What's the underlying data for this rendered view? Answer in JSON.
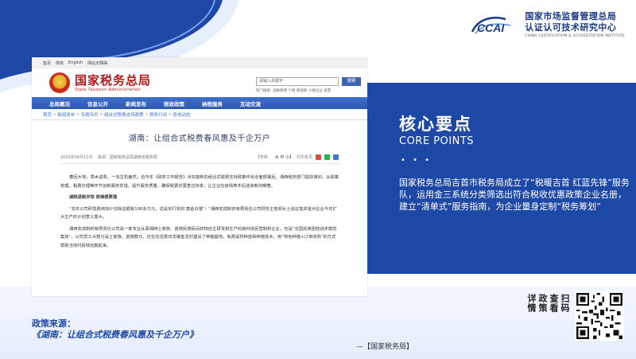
{
  "header": {
    "logo_mark": "CCAI",
    "org_name_line1": "国家市场监督管理总局",
    "org_name_line2": "认证认可技术研究中心",
    "org_name_en": "CHINA CERTIFICATION & ACCREDITATION INSTITUTE"
  },
  "screenshot": {
    "topbar": [
      "首页",
      "简体",
      "English",
      "网站无障碍"
    ],
    "site_title": "国家税务总局",
    "site_title_en": "State Taxation Administration",
    "search_placeholder": "请输入关键字",
    "search_button": "搜索",
    "hot_words": "热门搜索: 减税降费 个税 增值税 小微企业 发票",
    "nav": [
      "总局概况",
      "信息公开",
      "新闻发布",
      "税收政策",
      "纳税服务",
      "互动交流"
    ],
    "breadcrumb": [
      "首页",
      "新闻发布",
      "专题专栏",
      "组合式税费支持政策",
      "税务行动",
      "各地动态"
    ],
    "article_title": "湖南：让组合式税费春风惠及千企万户",
    "article_date": "2022年04月11日",
    "article_source": "来源：国家税务总局湖南省税务局",
    "font_label": "【字体：",
    "font_sizes": "大 中 小】",
    "print_label": "打印本页",
    "body": [
      "春回大地，草木返青，一派生机盎然。自今年《政府工作报告》对实施新的组合式税费支持政策作出全面部署后，湘西税务部门提前谋划，从政策梳理、税费办理等环节创新服务举措，提升服务质量，确保税费优惠直达快享，让企业在疫情寒冬后迎来新的暖春。",
      "减税退税并举 获得感更强",
      "“去年公司研发费用加计扣除总额有100多万元，这是实打实的‘真金白银’！”湘西宏成制药有限责任公司财务主管郑女士谈这笔资金对企业今年扩大生产的计划意义重大。",
      "湘西宏成制药有限责任公司是一家专业从事湘西土家族、苗族民族民间药物自主研发和生产的高科技民营制药企业，也是“全国民族团结进步模范集体”。公司员工大部分是土家族、苗族群众，还在花垣县双龙镇金龙村建设了种植基地，免费提供种苗和种植技术，用“特色种植+订单收购”的方式帮助当地村民钱包鼓起来。"
    ]
  },
  "panel": {
    "title": "核心要点",
    "subtitle": "CORE POINTS",
    "dots": "• • •",
    "text": "国家税务总局吉首市税务局成立了“税暖吉首 红蓝先锋”服务队，运用金三系统分类筛选出符合税收优惠政策企业名册，建立“清单式”服务指南，为企业量身定制“税务筹划”"
  },
  "footer": {
    "policy_label": "政策来源：",
    "policy_title": "《湖南：让组合式税费春风惠及千企万户》",
    "source_note": "—【国家税务局】",
    "scan_col1": "扫码",
    "scan_col2": "查看",
    "scan_col3": "政策",
    "scan_col4": "详情"
  },
  "colors": {
    "brand_blue": "#1e48a6",
    "site_red": "#b2191b",
    "nav_blue": "#2c58b2"
  }
}
